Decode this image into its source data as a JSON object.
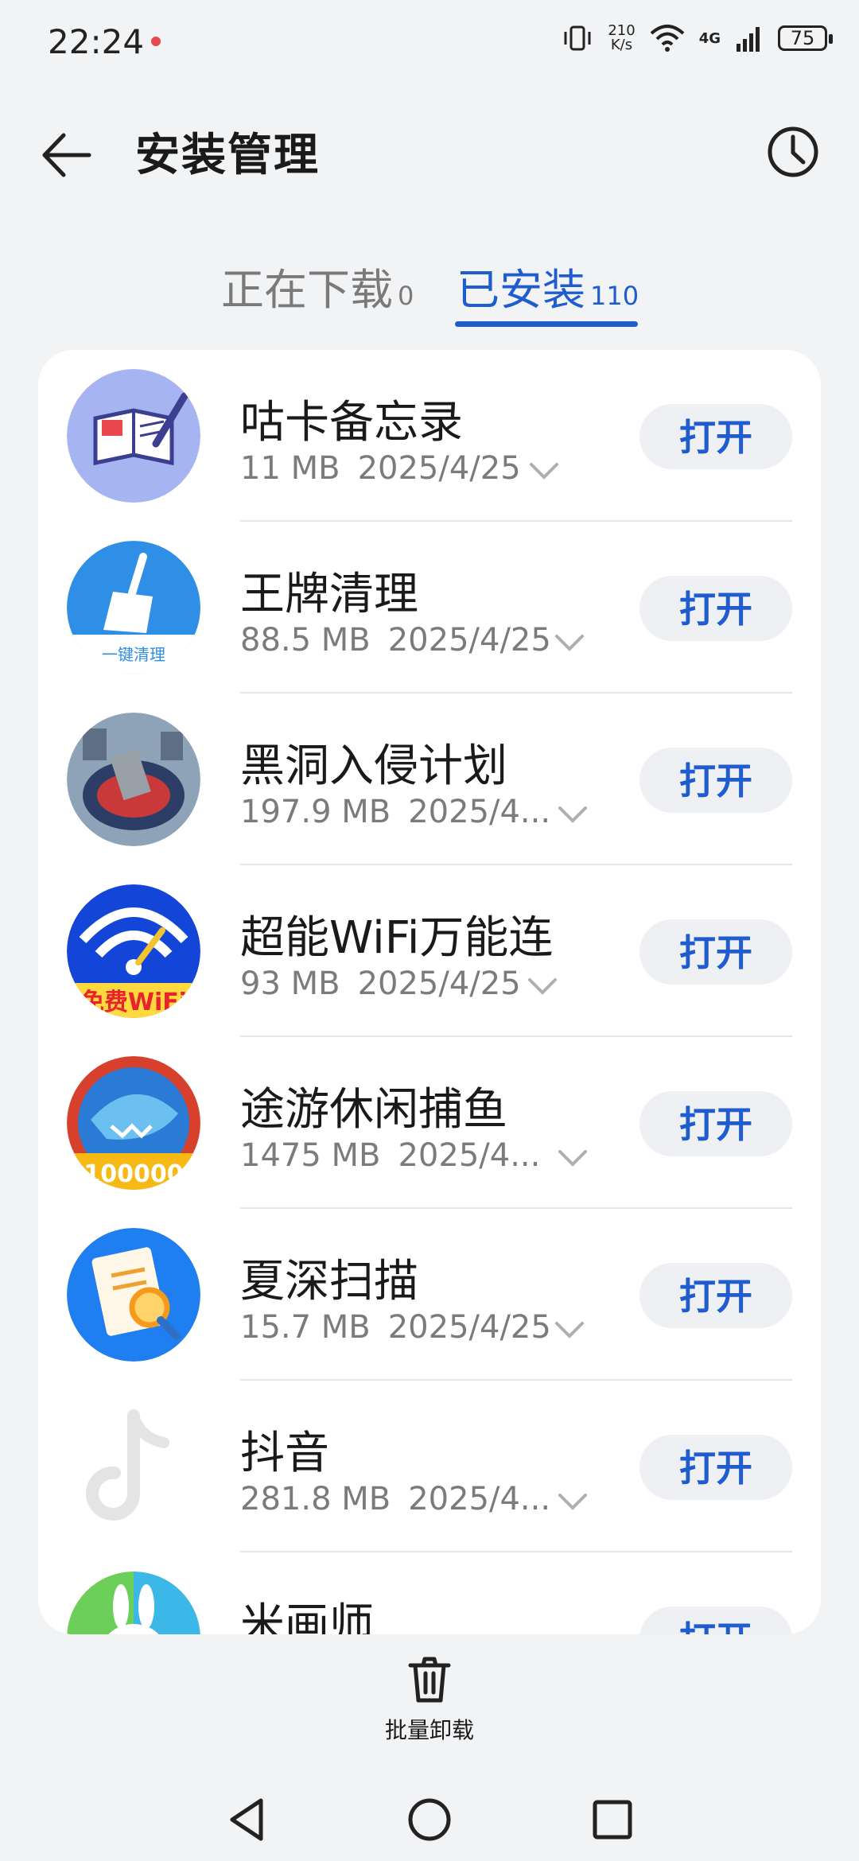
{
  "status_bar": {
    "time": "22:24",
    "net_speed_value": "210",
    "net_speed_unit": "K/s",
    "network": "4G",
    "battery": "75"
  },
  "header": {
    "title": "安装管理"
  },
  "tabs": [
    {
      "label": "正在下载",
      "count": "0",
      "active": false
    },
    {
      "label": "已安装",
      "count": "110",
      "active": true
    }
  ],
  "apps": [
    {
      "name": "咕卡备忘录",
      "size": "11 MB",
      "date": "2025/4/25",
      "button": "打开",
      "icon": "notebook-pen-icon"
    },
    {
      "name": "王牌清理",
      "size": "88.5 MB",
      "date": "2025/4/25",
      "button": "打开",
      "icon": "broom-cleaner-icon"
    },
    {
      "name": "黑洞入侵计划",
      "size": "197.9 MB",
      "date": "2025/4...",
      "button": "打开",
      "icon": "black-hole-game-icon"
    },
    {
      "name": "超能WiFi万能连",
      "size": "93 MB",
      "date": "2025/4/25",
      "button": "打开",
      "icon": "wifi-key-icon"
    },
    {
      "name": "途游休闲捕鱼",
      "size": "1475 MB",
      "date": "2025/4...",
      "button": "打开",
      "icon": "shark-fishing-icon"
    },
    {
      "name": "夏深扫描",
      "size": "15.7 MB",
      "date": "2025/4/25",
      "button": "打开",
      "icon": "document-scan-icon"
    },
    {
      "name": "抖音",
      "size": "281.8 MB",
      "date": "2025/4...",
      "button": "打开",
      "icon": "tiktok-note-icon"
    },
    {
      "name": "米画师",
      "size": "",
      "date": "",
      "button": "打开",
      "icon": "rainbow-rabbit-icon"
    }
  ],
  "bottom_action": {
    "label": "批量卸载",
    "icon": "trash-icon"
  },
  "colors": {
    "accent": "#1f5ccf",
    "background": "#f1f3f5",
    "button_bg": "#eef0f3"
  }
}
